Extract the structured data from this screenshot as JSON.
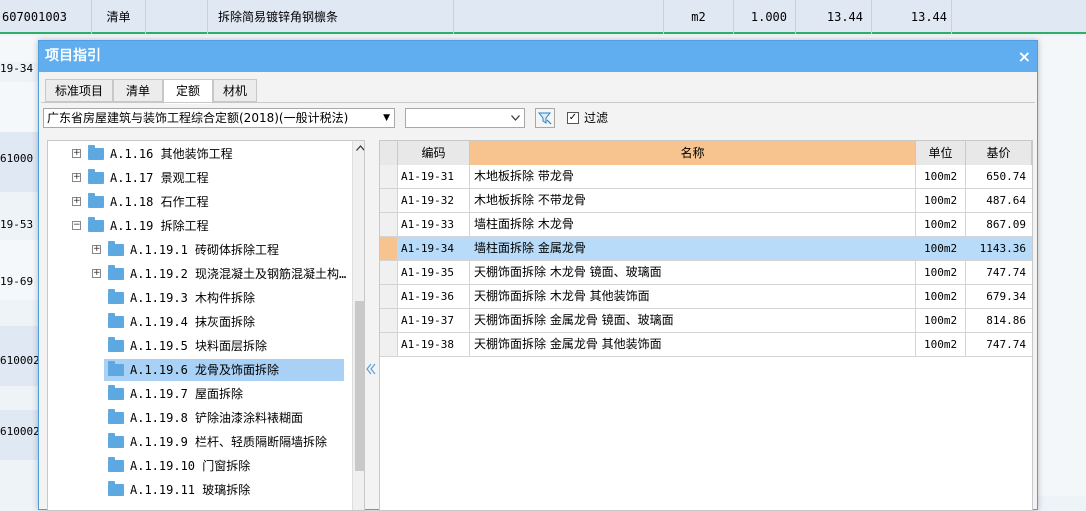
{
  "background": {
    "top_row": {
      "code": "607001003",
      "type": "清单",
      "name": "拆除简易镀锌角钢檩条",
      "unit": "m2",
      "qty": "1.000",
      "price": "13.44",
      "total": "13.44"
    },
    "side_labels": [
      "19-34",
      "61000",
      "19-53",
      "19-69",
      "610002",
      "610002"
    ]
  },
  "dialog": {
    "title": "项目指引",
    "close_glyph": "×",
    "tabs": [
      "标准项目",
      "清单",
      "定额",
      "材机"
    ],
    "active_tab": "定额",
    "quota_library": "广东省房屋建筑与装饰工程综合定额(2018)(一般计税法)",
    "filter_value": "",
    "filter_checkbox_label": "过滤",
    "filter_checked": true
  },
  "tree": {
    "items": [
      {
        "label": "A.1.16 其他装饰工程",
        "level": 0,
        "expander": "+"
      },
      {
        "label": "A.1.17 景观工程",
        "level": 0,
        "expander": "+"
      },
      {
        "label": "A.1.18 石作工程",
        "level": 0,
        "expander": "+"
      },
      {
        "label": "A.1.19 拆除工程",
        "level": 0,
        "expander": "−"
      },
      {
        "label": "A.1.19.1 砖砌体拆除工程",
        "level": 1,
        "expander": "+"
      },
      {
        "label": "A.1.19.2 现浇混凝土及钢筋混凝土构…",
        "level": 1,
        "expander": "+"
      },
      {
        "label": "A.1.19.3 木构件拆除",
        "level": 1,
        "expander": ""
      },
      {
        "label": "A.1.19.4 抹灰面拆除",
        "level": 1,
        "expander": ""
      },
      {
        "label": "A.1.19.5 块料面层拆除",
        "level": 1,
        "expander": ""
      },
      {
        "label": "A.1.19.6 龙骨及饰面拆除",
        "level": 1,
        "expander": "",
        "selected": true
      },
      {
        "label": "A.1.19.7 屋面拆除",
        "level": 1,
        "expander": ""
      },
      {
        "label": "A.1.19.8 铲除油漆涂料裱糊面",
        "level": 1,
        "expander": ""
      },
      {
        "label": "A.1.19.9 栏杆、轻质隔断隔墙拆除",
        "level": 1,
        "expander": ""
      },
      {
        "label": "A.1.19.10 门窗拆除",
        "level": 1,
        "expander": ""
      },
      {
        "label": "A.1.19.11 玻璃拆除",
        "level": 1,
        "expander": ""
      }
    ]
  },
  "table": {
    "columns": [
      "编码",
      "名称",
      "单位",
      "基价"
    ],
    "rows": [
      {
        "code": "A1-19-31",
        "name": "木地板拆除 带龙骨",
        "unit": "100m2",
        "price": "650.74"
      },
      {
        "code": "A1-19-32",
        "name": "木地板拆除 不带龙骨",
        "unit": "100m2",
        "price": "487.64"
      },
      {
        "code": "A1-19-33",
        "name": "墙柱面拆除 木龙骨",
        "unit": "100m2",
        "price": "867.09"
      },
      {
        "code": "A1-19-34",
        "name": "墙柱面拆除 金属龙骨",
        "unit": "100m2",
        "price": "1143.36",
        "selected": true
      },
      {
        "code": "A1-19-35",
        "name": "天棚饰面拆除 木龙骨 镜面、玻璃面",
        "unit": "100m2",
        "price": "747.74"
      },
      {
        "code": "A1-19-36",
        "name": "天棚饰面拆除 木龙骨 其他装饰面",
        "unit": "100m2",
        "price": "679.34"
      },
      {
        "code": "A1-19-37",
        "name": "天棚饰面拆除 金属龙骨 镜面、玻璃面",
        "unit": "100m2",
        "price": "814.86"
      },
      {
        "code": "A1-19-38",
        "name": "天棚饰面拆除 金属龙骨 其他装饰面",
        "unit": "100m2",
        "price": "747.74"
      }
    ]
  },
  "colors": {
    "titlebar": "#60aef0",
    "selection": "#b7dbf8",
    "header_highlight": "#f7c38f"
  }
}
